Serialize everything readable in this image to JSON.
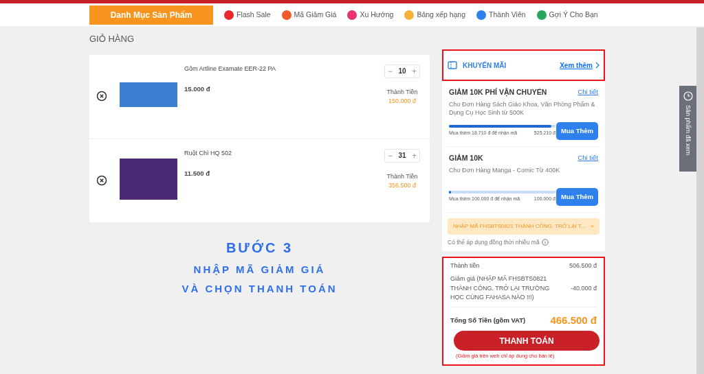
{
  "header": {
    "category_button": "Danh Mục Sản Phẩm",
    "nav": [
      {
        "label": "Flash Sale",
        "color": "#e8262b"
      },
      {
        "label": "Mã Giảm Giá",
        "color": "#f05a28"
      },
      {
        "label": "Xu Hướng",
        "color": "#e8336d"
      },
      {
        "label": "Bảng xếp hạng",
        "color": "#f6b23c"
      },
      {
        "label": "Thành Viên",
        "color": "#2f80ed"
      },
      {
        "label": "Gợi Ý Cho Bạn",
        "color": "#27a65a"
      }
    ]
  },
  "page_title": "GIỎ HÀNG",
  "cart_items": [
    {
      "name": "Gôm Artline Examate EER-22 PA",
      "price": "15.000 đ",
      "minus": "−",
      "quantity": "10",
      "plus": "+",
      "total_label": "Thành Tiền",
      "total": "150.000 đ"
    },
    {
      "name": "Ruột Chì HQ 502",
      "price": "11.500 đ",
      "minus": "−",
      "quantity": "31",
      "plus": "+",
      "total_label": "Thành Tiền",
      "total": "356.500 đ"
    }
  ],
  "step_banner": {
    "title": "BƯỚC 3",
    "lines": [
      "NHẬP MÃ GIẢM GIÁ",
      "VÀ CHỌN THANH TOÁN"
    ]
  },
  "promotions": {
    "title": "KHUYẾN MÃI",
    "more_link": "Xem thêm",
    "highlighted": true,
    "offers": [
      {
        "title": "GIẢM 10K PHÍ VẬN CHUYỂN",
        "detail_link": "Chi tiết",
        "description": "Cho Đơn Hàng Sách Giáo Khoa, Văn Phòng Phẩm & Dụng Cụ Học Sinh từ 500K",
        "progress_note": "Mua thêm 18.710 đ để nhận mã",
        "target": "525.210 đ",
        "level": 0.96,
        "button": "Mua Thêm"
      },
      {
        "title": "GIẢM 10K",
        "detail_link": "Chi tiết",
        "description": "Cho Đơn Hàng Manga - Comic Từ 400K",
        "progress_note": "Mua thêm 100.000 đ để nhận mã",
        "target": "100.000 đ",
        "level": 0,
        "button": "Mua Thêm"
      }
    ],
    "applied_code": "NHẬP MÃ FHSBTS0821 THÀNH CÔNG. TRỞ LẠI T...",
    "remove_symbol": "×",
    "note": "Có thể áp dụng đồng thời nhiều mã"
  },
  "summary": {
    "highlighted": true,
    "rows": [
      {
        "label": "Thành tiền",
        "value": "506.500 đ"
      },
      {
        "label": "Giảm giá (NHẬP MÃ FHSBTS0821 THÀNH CÔNG. TRỞ LẠI TRƯỜNG HỌC CÙNG FAHASA NÀO !!!)",
        "value": "-40.000 đ"
      }
    ],
    "total_label": "Tổng Số Tiền (gồm VAT)",
    "total": "466.500 đ",
    "checkout_button": "THANH TOÁN",
    "footnote": "(Giảm giá trên web chỉ áp dụng cho bán lẻ)"
  },
  "side_tab": {
    "label": "Sản phẩm đã xem"
  }
}
